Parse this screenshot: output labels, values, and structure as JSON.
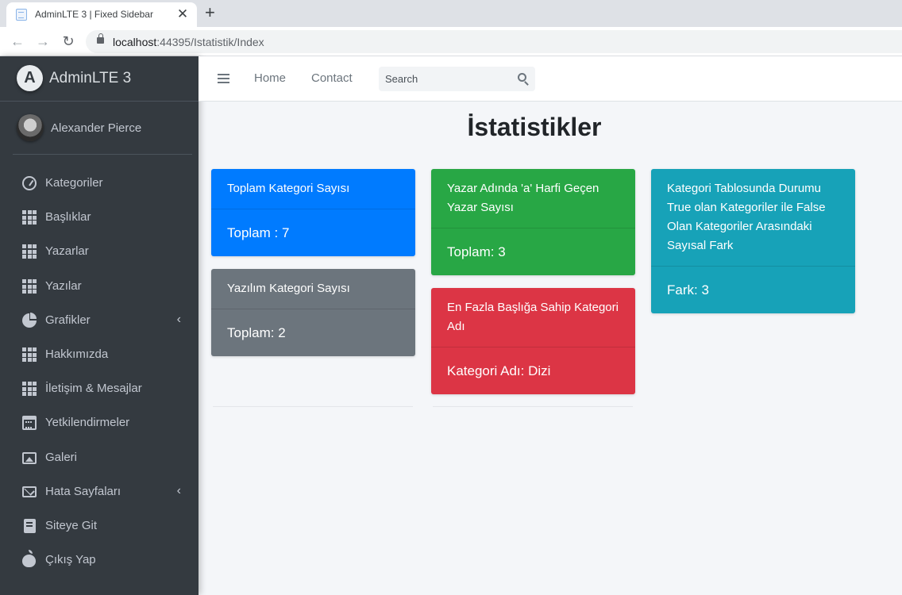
{
  "browser": {
    "tab_title": "AdminLTE 3 | Fixed Sidebar",
    "url_host": "localhost",
    "url_rest": ":44395/Istatistik/Index",
    "close_glyph": "✕",
    "newtab_glyph": "+",
    "back_glyph": "←",
    "forward_glyph": "→",
    "reload_glyph": "↻"
  },
  "sidebar": {
    "brand": "AdminLTE 3",
    "user_name": "Alexander Pierce",
    "chevron_glyph": "‹",
    "items": [
      {
        "label": "Kategoriler",
        "icon": "tachometer-icon"
      },
      {
        "label": "Başlıklar",
        "icon": "grid-icon"
      },
      {
        "label": "Yazarlar",
        "icon": "grid-icon"
      },
      {
        "label": "Yazılar",
        "icon": "grid-icon"
      },
      {
        "label": "Grafikler",
        "icon": "pie-chart-icon"
      },
      {
        "label": "Hakkımızda",
        "icon": "grid-icon"
      },
      {
        "label": "İletişim & Mesajlar",
        "icon": "grid-icon"
      },
      {
        "label": "Yetkilendirmeler",
        "icon": "calendar-icon"
      },
      {
        "label": "Galeri",
        "icon": "image-icon"
      },
      {
        "label": "Hata Sayfaları",
        "icon": "envelope-icon"
      },
      {
        "label": "Siteye Git",
        "icon": "book-icon"
      },
      {
        "label": "Çıkış Yap",
        "icon": "apple-icon"
      }
    ]
  },
  "navbar": {
    "home": "Home",
    "contact": "Contact",
    "search_placeholder": "Search"
  },
  "main": {
    "title": "İstatistikler",
    "cards": [
      {
        "header": "Toplam Kategori Sayısı",
        "body": "Toplam : 7",
        "color": "#007bff"
      },
      {
        "header": "Yazılım Kategori Sayısı",
        "body": "Toplam: 2",
        "color": "#6c757d"
      },
      {
        "header": "Yazar Adında 'a' Harfi Geçen Yazar Sayısı",
        "body": "Toplam: 3",
        "color": "#28a745"
      },
      {
        "header": "En Fazla Başlığa Sahip Kategori Adı",
        "body": "Kategori Adı: Dizi",
        "color": "#dc3545"
      },
      {
        "header": "Kategori Tablosunda Durumu True olan Kategoriler ile False Olan Kategoriler Arasındaki Sayısal Fark",
        "body": "Fark: 3",
        "color": "#17a2b8"
      }
    ]
  }
}
